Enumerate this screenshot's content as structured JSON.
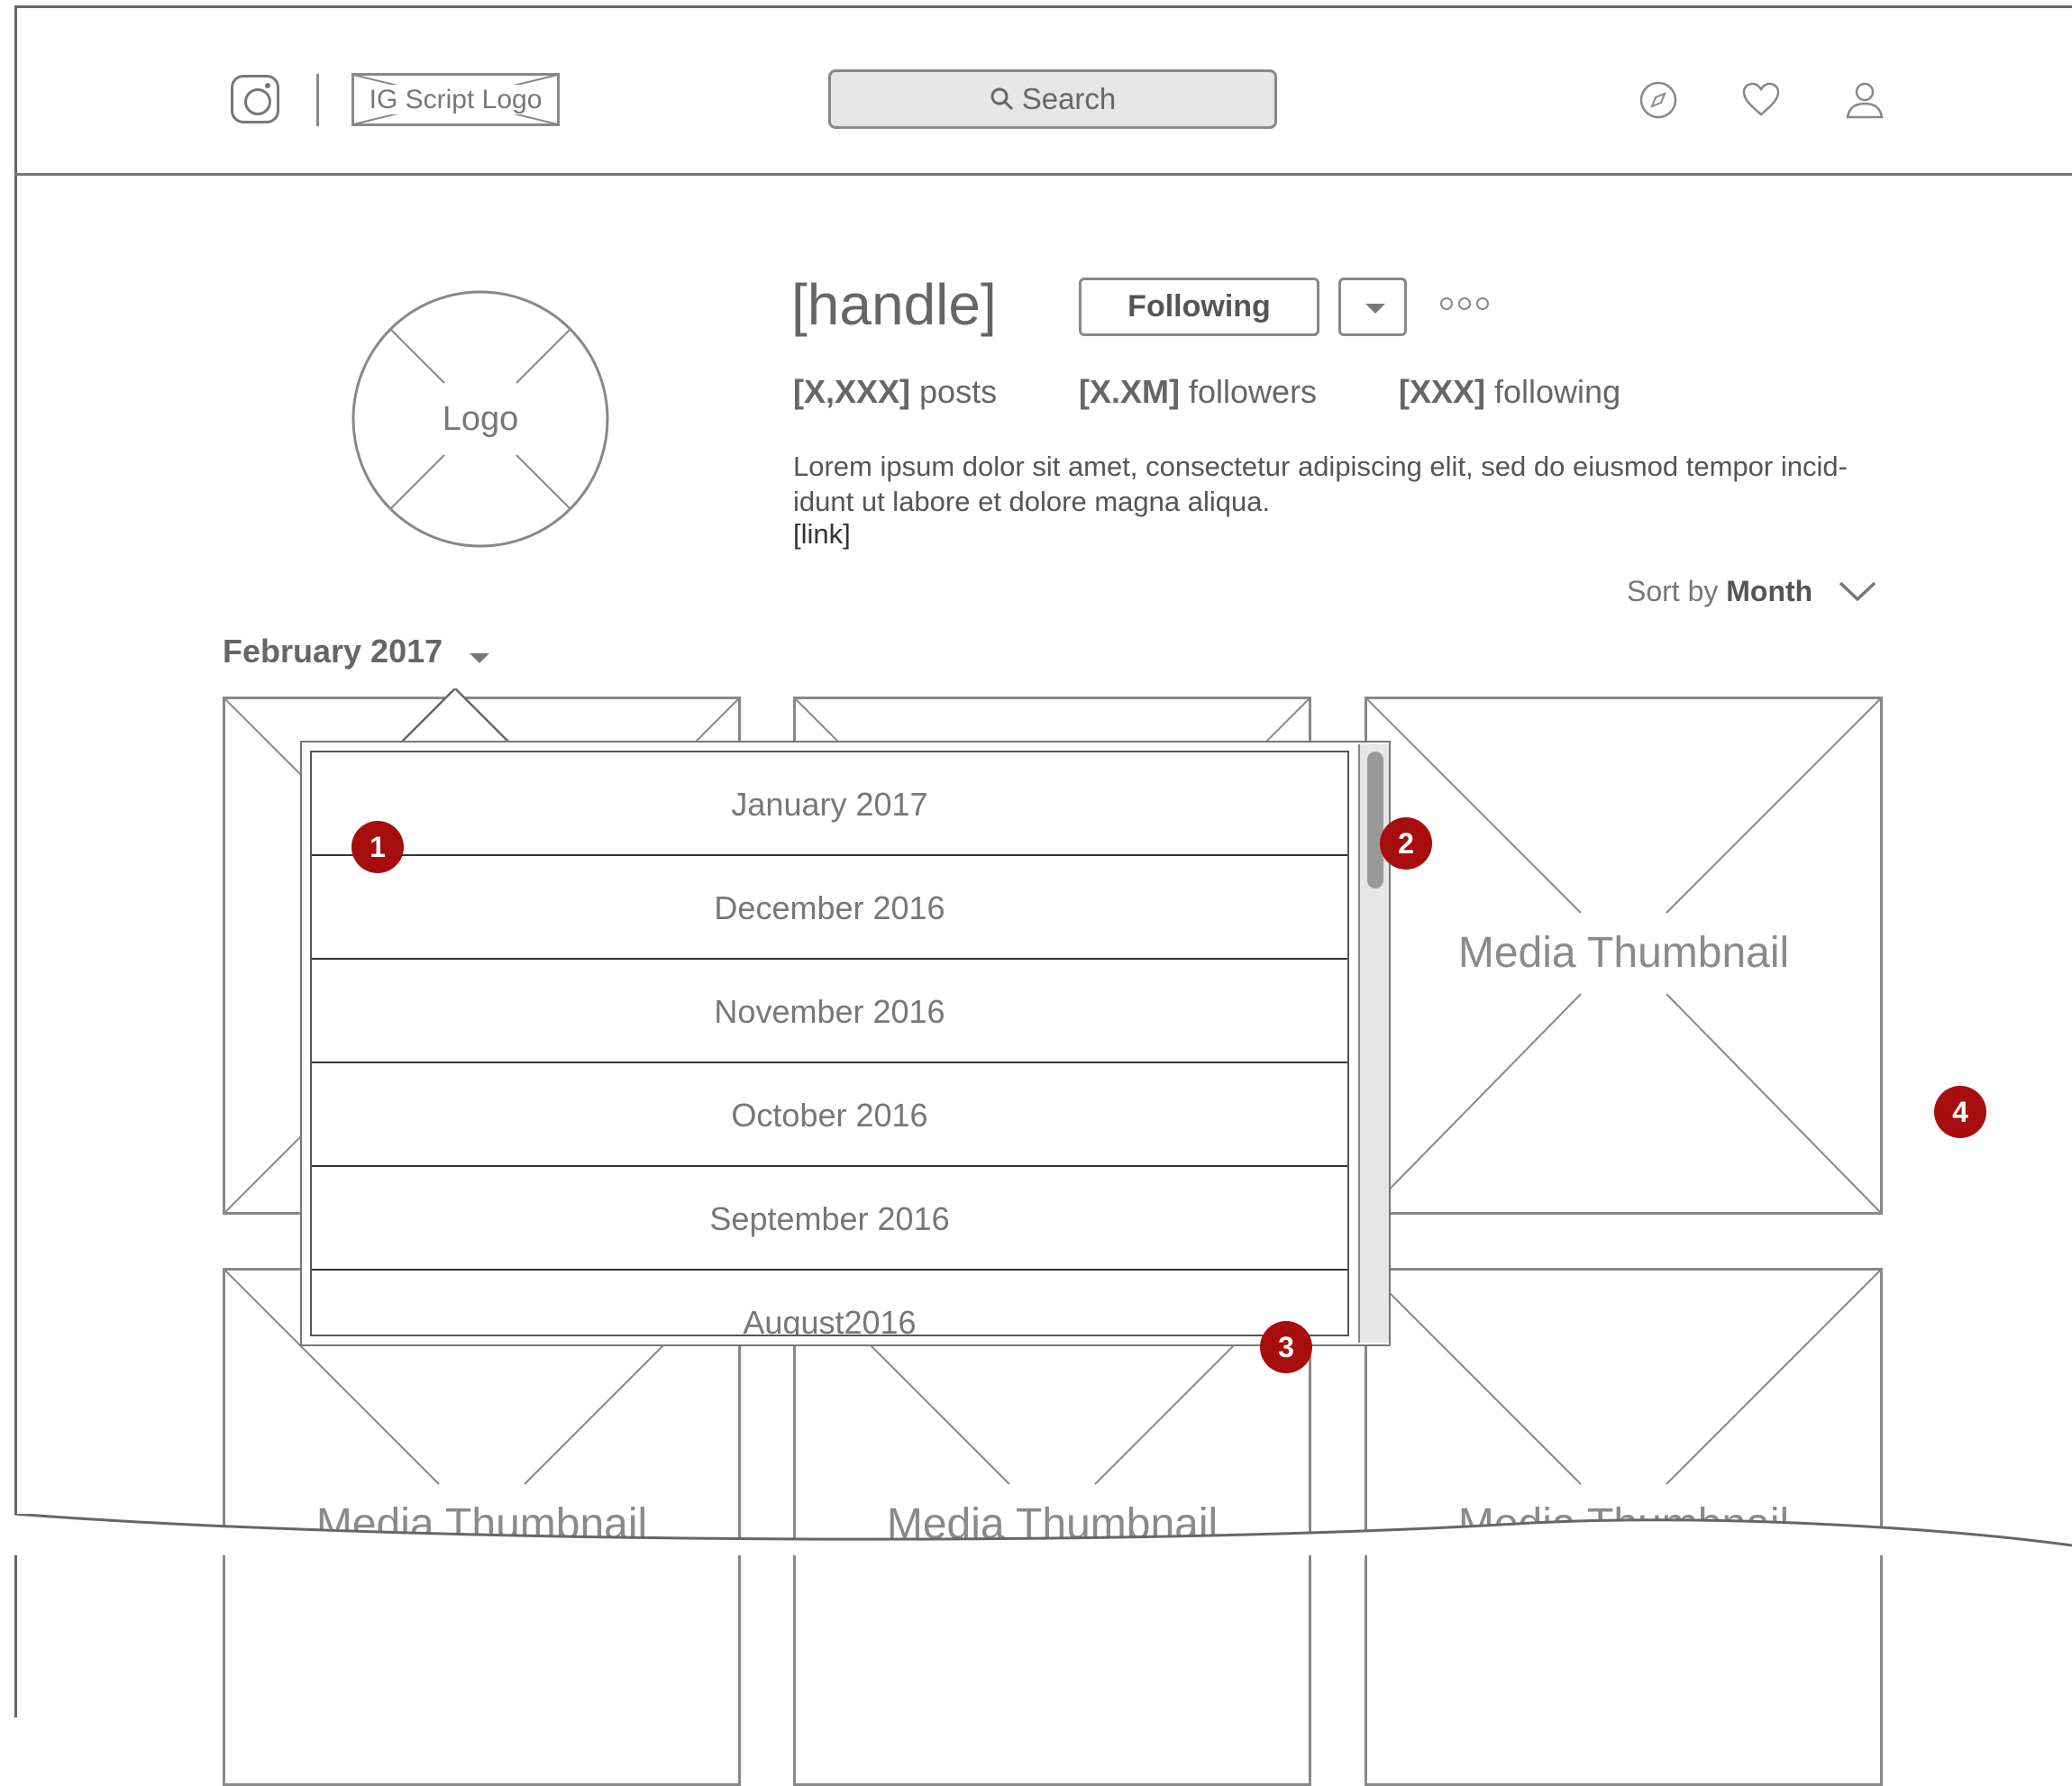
{
  "header": {
    "script_logo_label": "IG Script Logo",
    "search_label": "Search",
    "nav_icons": [
      "compass-icon",
      "heart-icon",
      "user-icon"
    ]
  },
  "profile": {
    "avatar_label": "Logo",
    "handle": "[handle]",
    "following_label": "Following",
    "stats": {
      "posts_value": "[X,XXX]",
      "posts_label": " posts",
      "followers_value": "[X.XM]",
      "followers_label": " followers",
      "following_value": "[XXX]",
      "following_label": " following"
    },
    "bio": "Lorem ipsum dolor sit amet, consectetur adipiscing elit, sed do eiusmod tempor incid-idunt ut labore et dolore magna aliqua.",
    "link": "[link]"
  },
  "sort": {
    "prefix": "Sort by ",
    "value": "Month"
  },
  "month_selector": {
    "selected": "February 2017",
    "options": [
      "January 2017",
      "December 2016",
      "November 2016",
      "October 2016",
      "September 2016",
      "August2016"
    ]
  },
  "thumbnails": {
    "caption": "Media Thumbnail"
  },
  "annotations": [
    "1",
    "2",
    "3",
    "4"
  ]
}
